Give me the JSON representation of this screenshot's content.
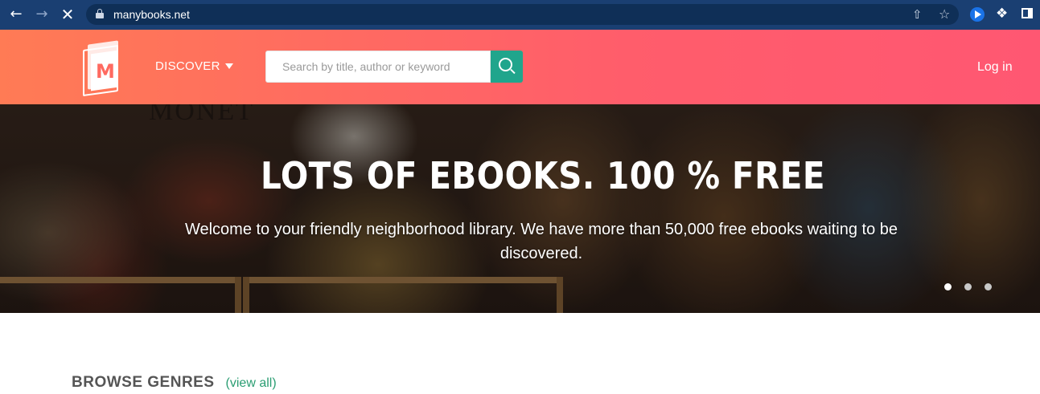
{
  "browser": {
    "url": "manybooks.net",
    "icons": [
      "back-arrow-icon",
      "forward-arrow-icon",
      "stop-loading-icon",
      "lock-icon",
      "share-icon",
      "star-icon",
      "extension-icon",
      "puzzle-icon",
      "sidepanel-icon"
    ]
  },
  "header": {
    "logo_letter": "M",
    "discover_label": "DISCOVER",
    "search_placeholder": "Search by title, author or keyword",
    "login_label": "Log in",
    "colors": {
      "gradient_start": "#ff7b55",
      "gradient_end": "#ff5772",
      "search_button": "#20a58c"
    }
  },
  "hero": {
    "background_text": "MONET",
    "title": "LOTS OF EBOOKS. 100 % FREE",
    "subtitle": "Welcome to your friendly neighborhood library. We have more than 50,000 free ebooks waiting to be discovered.",
    "slides": 3,
    "active_slide": 1
  },
  "browse": {
    "title": "BROWSE GENRES",
    "view_all": "(view all)",
    "link_color": "#2a9d72"
  }
}
